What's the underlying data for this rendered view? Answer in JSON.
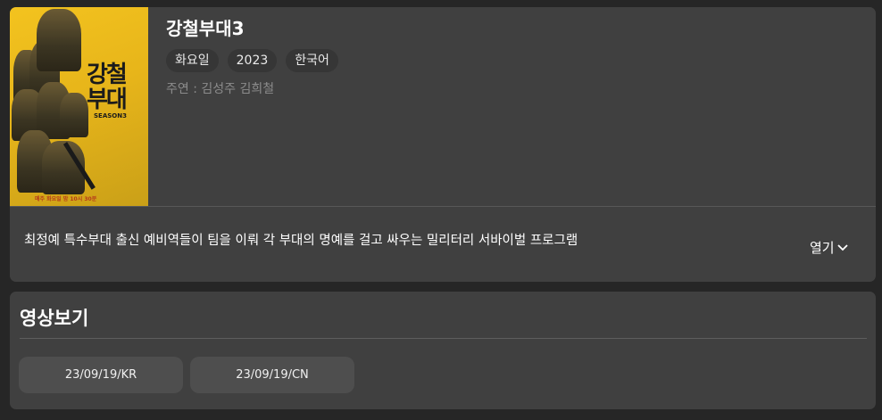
{
  "show": {
    "title": "강철부대3",
    "tags": [
      "화요일",
      "2023",
      "한국어"
    ],
    "cast": "주연 : 김성주 김희철",
    "synopsis": "최정예 특수부대 출신 예비역들이 팀을 이뤄 각 부대의 명예를 걸고 싸우는 밀리터리 서바이벌 프로그램",
    "expand_label": "열기",
    "poster": {
      "title": "강철부대",
      "season": "SEASON3",
      "airtime": "매주 화요일 밤 10시 30분"
    }
  },
  "videos": {
    "section_title": "영상보기",
    "episodes": [
      "23/09/19/KR",
      "23/09/19/CN"
    ]
  },
  "colors": {
    "page_bg": "#262626",
    "card_bg": "#404040",
    "tag_bg": "#363636",
    "episode_bg": "#4e4e4e",
    "muted_text": "#8c8c8c",
    "poster_yellow": "#f3c31f"
  }
}
